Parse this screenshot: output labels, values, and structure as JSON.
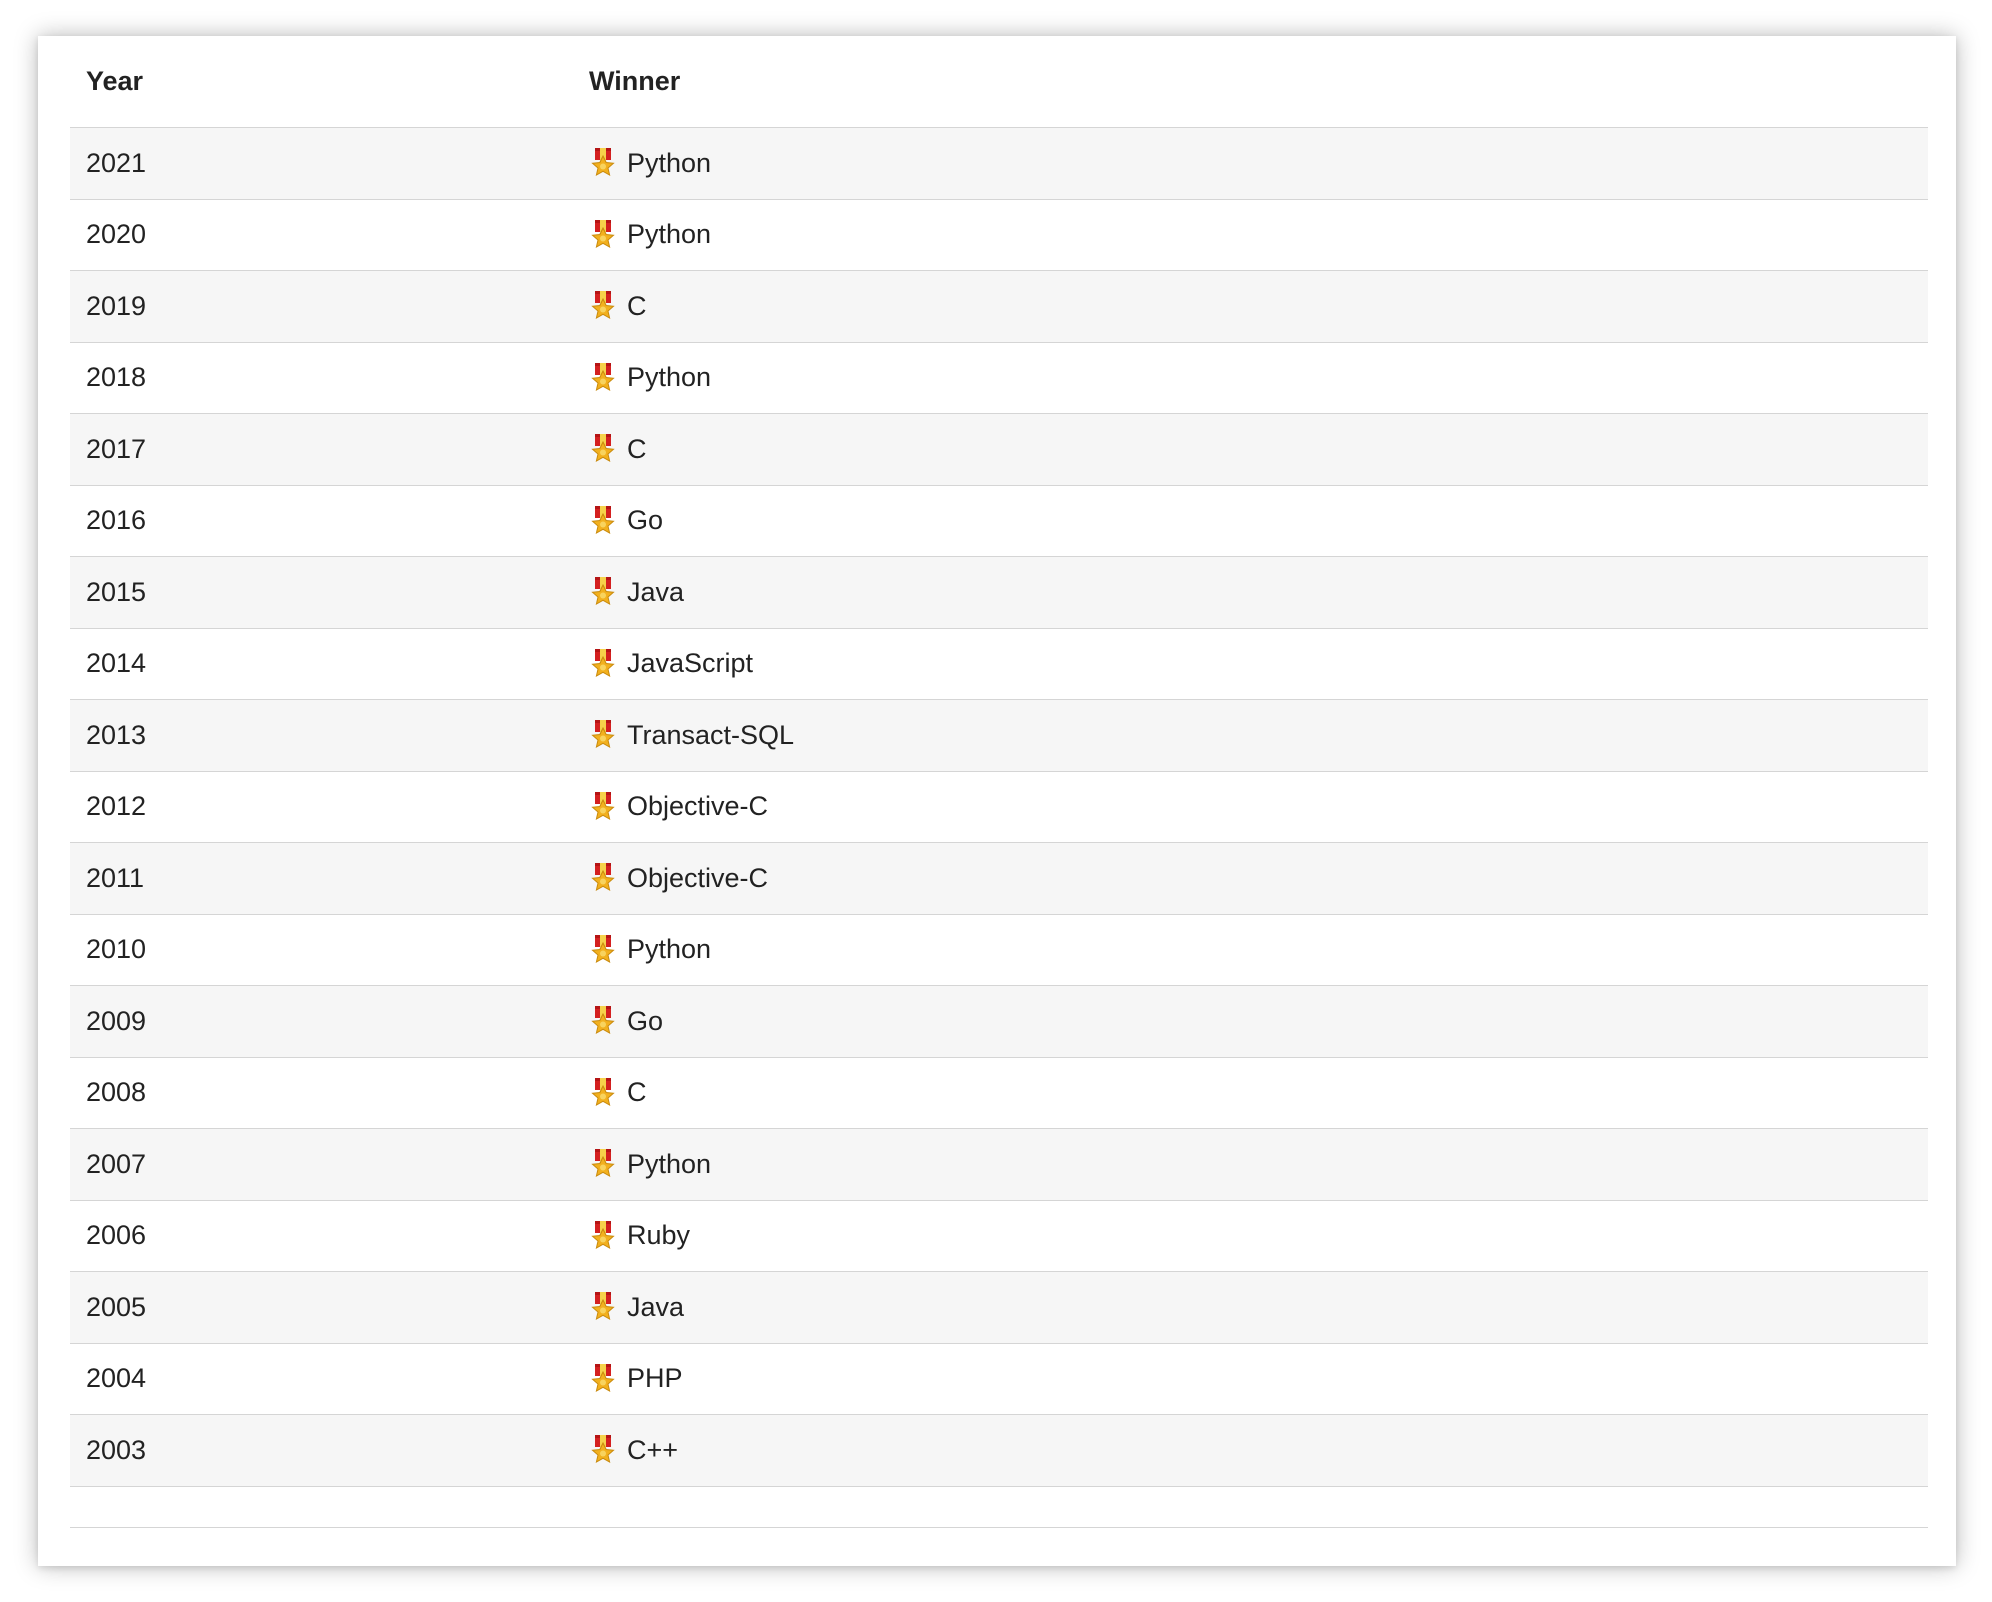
{
  "table": {
    "headers": {
      "year": "Year",
      "winner": "Winner"
    },
    "rows": [
      {
        "year": "2021",
        "winner": "Python"
      },
      {
        "year": "2020",
        "winner": "Python"
      },
      {
        "year": "2019",
        "winner": "C"
      },
      {
        "year": "2018",
        "winner": "Python"
      },
      {
        "year": "2017",
        "winner": "C"
      },
      {
        "year": "2016",
        "winner": "Go"
      },
      {
        "year": "2015",
        "winner": "Java"
      },
      {
        "year": "2014",
        "winner": "JavaScript"
      },
      {
        "year": "2013",
        "winner": "Transact-SQL"
      },
      {
        "year": "2012",
        "winner": "Objective-C"
      },
      {
        "year": "2011",
        "winner": "Objective-C"
      },
      {
        "year": "2010",
        "winner": "Python"
      },
      {
        "year": "2009",
        "winner": "Go"
      },
      {
        "year": "2008",
        "winner": "C"
      },
      {
        "year": "2007",
        "winner": "Python"
      },
      {
        "year": "2006",
        "winner": "Ruby"
      },
      {
        "year": "2005",
        "winner": "Java"
      },
      {
        "year": "2004",
        "winner": "PHP"
      },
      {
        "year": "2003",
        "winner": "C++"
      }
    ],
    "winner_icon": "medal-icon"
  },
  "colors": {
    "row_stripe": "#f6f6f6",
    "border": "#d5d5d5",
    "text": "#222222",
    "medal_ribbon": "#d42020",
    "medal_gold": "#f2b01e"
  }
}
